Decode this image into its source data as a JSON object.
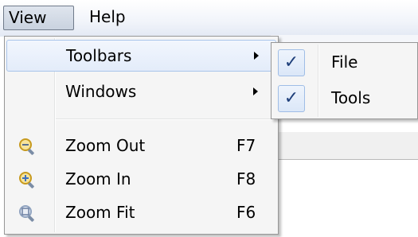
{
  "menubar": {
    "view_label": "View",
    "help_label": "Help"
  },
  "view_menu": {
    "items": [
      {
        "label": "Toolbars",
        "has_submenu": true,
        "highlighted": true
      },
      {
        "label": "Windows",
        "has_submenu": true
      },
      {
        "label": "Zoom Out",
        "shortcut": "F7",
        "icon": "zoom-out-icon"
      },
      {
        "label": "Zoom In",
        "shortcut": "F8",
        "icon": "zoom-in-icon"
      },
      {
        "label": "Zoom Fit",
        "shortcut": "F6",
        "icon": "zoom-fit-icon"
      }
    ]
  },
  "toolbars_submenu": {
    "check_glyph": "✓",
    "items": [
      {
        "label": "File",
        "checked": true
      },
      {
        "label": "Tools",
        "checked": true
      }
    ]
  },
  "colors": {
    "highlight_border": "#a9c4ea",
    "menu_background": "#f5f5f5",
    "icon_lens": "#e5b838"
  }
}
